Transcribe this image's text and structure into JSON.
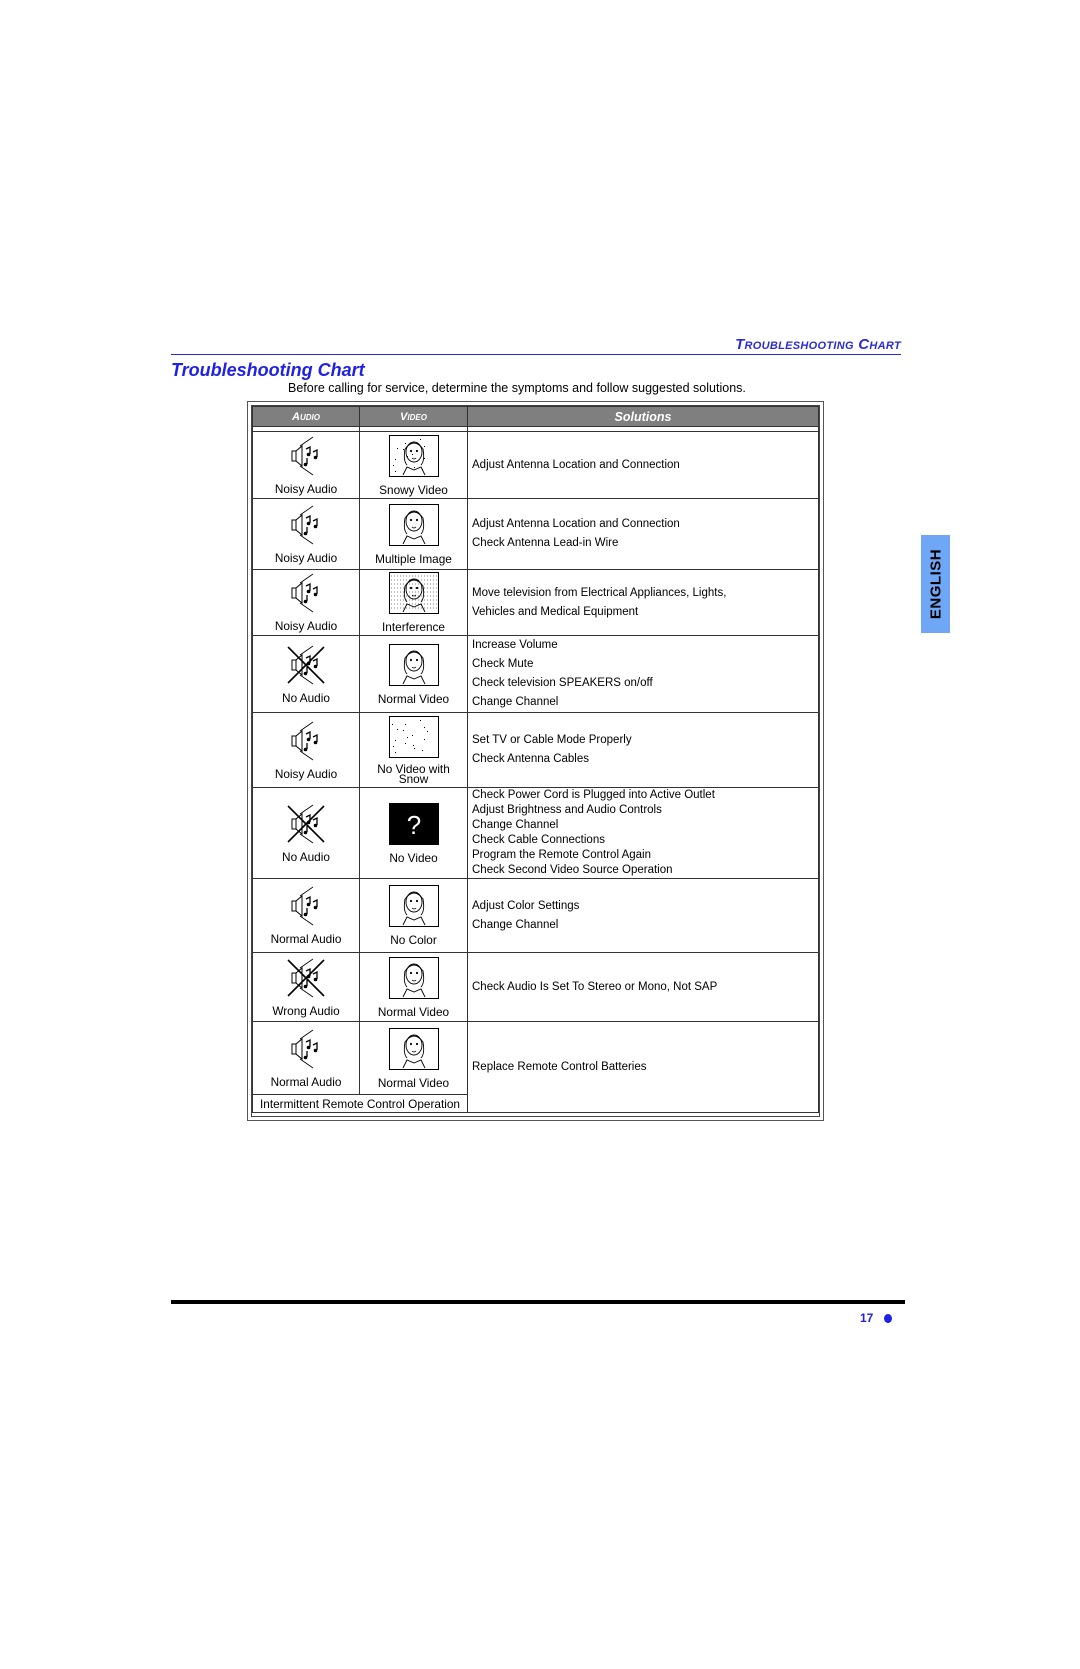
{
  "header": {
    "running_head": "Troubleshooting Chart",
    "title": "Troubleshooting Chart",
    "intro": "Before calling for service, determine the symptoms and follow suggested solutions."
  },
  "table": {
    "columns": {
      "audio": "Audio",
      "video": "Video",
      "solutions": "Solutions"
    },
    "rows": [
      {
        "audio": {
          "label": "Noisy Audio",
          "icon": "speaker-noisy-icon"
        },
        "video": {
          "label": "Snowy Video",
          "icon": "tv-snowy-face-icon"
        },
        "solutions": [
          "Adjust Antenna Location and Connection"
        ]
      },
      {
        "audio": {
          "label": "Noisy Audio",
          "icon": "speaker-noisy-icon"
        },
        "video": {
          "label": "Multiple Image",
          "icon": "tv-ghost-face-icon"
        },
        "solutions": [
          "Adjust Antenna Location and Connection",
          "Check Antenna Lead-in Wire"
        ]
      },
      {
        "audio": {
          "label": "Noisy Audio",
          "icon": "speaker-noisy-icon"
        },
        "video": {
          "label": "Interference",
          "icon": "tv-interference-face-icon"
        },
        "solutions": [
          "Move television from Electrical Appliances, Lights,",
          "Vehicles and Medical Equipment"
        ]
      },
      {
        "audio": {
          "label": "No Audio",
          "icon": "speaker-crossed-icon"
        },
        "video": {
          "label": "Normal Video",
          "icon": "tv-face-icon"
        },
        "solutions": [
          "Increase Volume",
          "Check Mute",
          "Check television SPEAKERS on/off",
          "Change Channel"
        ]
      },
      {
        "audio": {
          "label": "Noisy Audio",
          "icon": "speaker-noisy-icon"
        },
        "video": {
          "label": "No Video with Snow",
          "icon": "tv-snow-only-icon"
        },
        "solutions": [
          "Set TV or Cable Mode Properly",
          "Check Antenna Cables"
        ]
      },
      {
        "audio": {
          "label": "No Audio",
          "icon": "speaker-crossed-icon"
        },
        "video": {
          "label": "No Video",
          "icon": "tv-question-mark-icon",
          "glyph": "?"
        },
        "solutions": [
          "Check Power Cord is Plugged into Active Outlet",
          "Adjust Brightness and Audio Controls",
          "Change Channel",
          "Check Cable Connections",
          "Program the Remote Control Again",
          "Check Second Video Source Operation"
        ]
      },
      {
        "audio": {
          "label": "Normal Audio",
          "icon": "speaker-noisy-icon"
        },
        "video": {
          "label": "No Color",
          "icon": "tv-face-icon"
        },
        "solutions": [
          "Adjust Color Settings",
          "Change Channel"
        ]
      },
      {
        "audio": {
          "label": "Wrong Audio",
          "icon": "speaker-crossed-icon"
        },
        "video": {
          "label": "Normal Video",
          "icon": "tv-face-icon"
        },
        "solutions": [
          "Check Audio Is Set To Stereo or Mono, Not SAP"
        ]
      },
      {
        "audio": {
          "label": "Normal Audio",
          "icon": "speaker-noisy-icon"
        },
        "video": {
          "label": "Normal Video",
          "icon": "tv-face-icon"
        },
        "note": "Intermittent Remote Control Operation",
        "solutions": [
          "Replace Remote Control Batteries"
        ]
      }
    ]
  },
  "side_tab": {
    "label": "ENGLISH",
    "color": "#6fa7f6"
  },
  "footer": {
    "page_number": "17"
  },
  "colors": {
    "accent_blue": "#1f22e6",
    "header_gray": "#7f7f7f"
  }
}
